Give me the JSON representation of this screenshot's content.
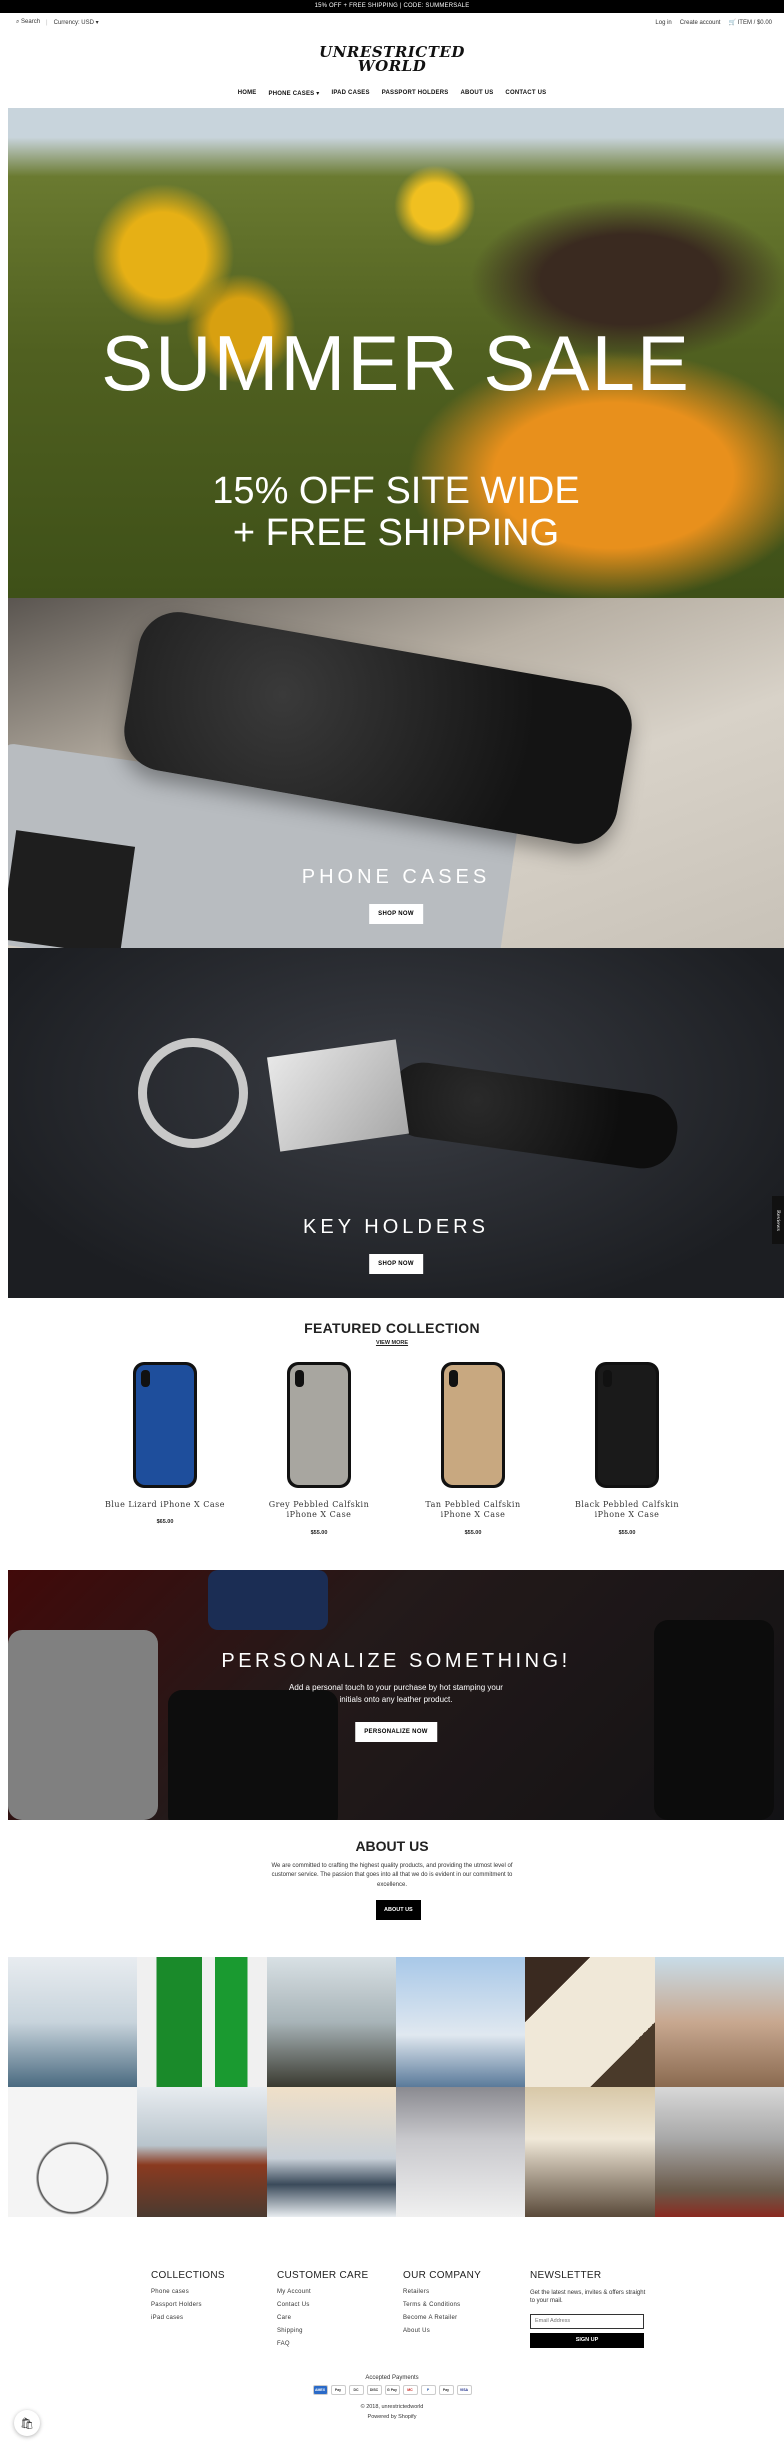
{
  "announcement": "15% OFF + FREE SHIPPING | CODE: SUMMERSALE",
  "topbar": {
    "search": "Search",
    "currency_label": "Currency:",
    "currency_value": "USD",
    "login": "Log in",
    "create_account": "Create account",
    "cart": "ITEM / $0.00"
  },
  "brand": {
    "line1": "UNRESTRICTED",
    "line2": "WORLD"
  },
  "nav": [
    "HOME",
    "PHONE CASES",
    "IPAD CASES",
    "PASSPORT HOLDERS",
    "ABOUT US",
    "CONTACT US"
  ],
  "hero": {
    "title": "SUMMER SALE",
    "line1": "15% OFF SITE WIDE",
    "line2": "+ FREE SHIPPING"
  },
  "collections": [
    {
      "title": "PHONE CASES",
      "button": "SHOP NOW"
    },
    {
      "title": "KEY HOLDERS",
      "button": "SHOP NOW"
    }
  ],
  "featured": {
    "heading": "FEATURED COLLECTION",
    "view_more": "VIEW MORE",
    "products": [
      {
        "name": "Blue Lizard iPhone X Case",
        "price": "$65.00",
        "color": "#1e4e9c"
      },
      {
        "name": "Grey Pebbled Calfskin iPhone X Case",
        "price": "$55.00",
        "color": "#a8a6a0"
      },
      {
        "name": "Tan Pebbled Calfskin iPhone X Case",
        "price": "$55.00",
        "color": "#c8a880"
      },
      {
        "name": "Black Pebbled Calfskin iPhone X Case",
        "price": "$55.00",
        "color": "#1a1a1a"
      }
    ]
  },
  "personalize": {
    "title": "PERSONALIZE SOMETHING!",
    "desc1": "Add a personal touch to your purchase by hot stamping your",
    "desc2": "initials onto any leather product.",
    "button": "PERSONALIZE NOW"
  },
  "about": {
    "heading": "ABOUT US",
    "text": "We are committed to crafting the highest quality products, and providing the utmost level of customer service. The passion that goes into all that we do is evident in our commitment to excellence.",
    "button": "ABOUT US"
  },
  "footer": {
    "collections": {
      "heading": "COLLECTIONS",
      "links": [
        "Phone cases",
        "Passport Holders",
        "iPad cases"
      ]
    },
    "customer_care": {
      "heading": "CUSTOMER CARE",
      "links": [
        "My Account",
        "Contact Us",
        "Care",
        "Shipping",
        "FAQ"
      ]
    },
    "our_company": {
      "heading": "OUR COMPANY",
      "links": [
        "Retailers",
        "Terms & Conditions",
        "Become A Retailer",
        "About Us"
      ]
    },
    "newsletter": {
      "heading": "NEWSLETTER",
      "text": "Get the latest news, invites & offers straight to your mail.",
      "placeholder": "Email Address",
      "button": "SIGN UP"
    },
    "payments_heading": "Accepted Payments",
    "payments": [
      "AMEX",
      "Pay",
      "DC",
      "DISC",
      "G Pay",
      "MC",
      "P",
      "Pay",
      "VISA"
    ],
    "copyright": "© 2018, unrestrictedworld",
    "powered": "Powered by Shopify"
  },
  "side_tab": "Reviews"
}
